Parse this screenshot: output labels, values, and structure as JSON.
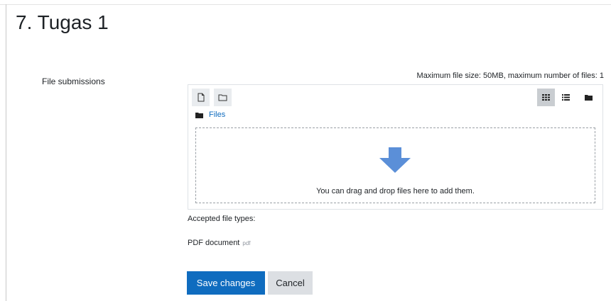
{
  "page": {
    "title": "7. Tugas 1"
  },
  "form": {
    "field_label": "File submissions",
    "limits_text": "Maximum file size: 50MB, maximum number of files: 1",
    "accepted_label": "Accepted file types:",
    "filetype_name": "PDF document",
    "filetype_ext": "pdf"
  },
  "filepicker": {
    "toolbar_left": [
      {
        "icon": "add-file-icon"
      },
      {
        "icon": "create-folder-icon"
      }
    ],
    "view_modes": [
      {
        "icon": "grid-view-icon",
        "active": true
      },
      {
        "icon": "list-view-icon",
        "active": false
      },
      {
        "icon": "tree-view-icon",
        "active": false
      }
    ],
    "path_label": "Files",
    "drop_message": "You can drag and drop files here to add them."
  },
  "buttons": {
    "save": "Save changes",
    "cancel": "Cancel"
  },
  "colors": {
    "primary": "#0f6cbf",
    "arrow": "#5b8fd8",
    "secondary_button": "#dcdfe3",
    "toolbar_button": "#e9ecef"
  }
}
